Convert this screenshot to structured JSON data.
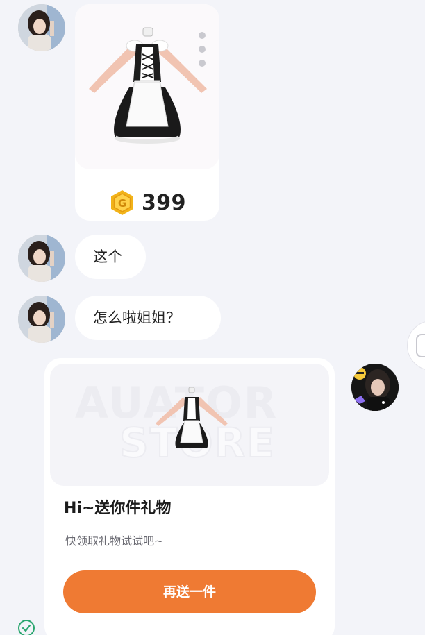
{
  "conversation": {
    "gift_item": {
      "price": "399",
      "currency_icon": "gold-coin-icon",
      "menu_icon": "vertical-dots-icon"
    },
    "messages": [
      {
        "text": "这个"
      },
      {
        "text": "怎么啦姐姐？"
      }
    ],
    "gift_message": {
      "banner_watermark_top": "AUATOR",
      "banner_watermark_bottom": "STORE",
      "title": "Hi~送你件礼物",
      "subtitle": "快领取礼物试试吧~",
      "button_label": "再送一件",
      "status_icon": "sent-check-icon"
    }
  },
  "colors": {
    "background": "#f3f4f9",
    "accent_button": "#ef7a33",
    "coin_gold": "#f2b319",
    "sent_check": "#2aa66f"
  }
}
